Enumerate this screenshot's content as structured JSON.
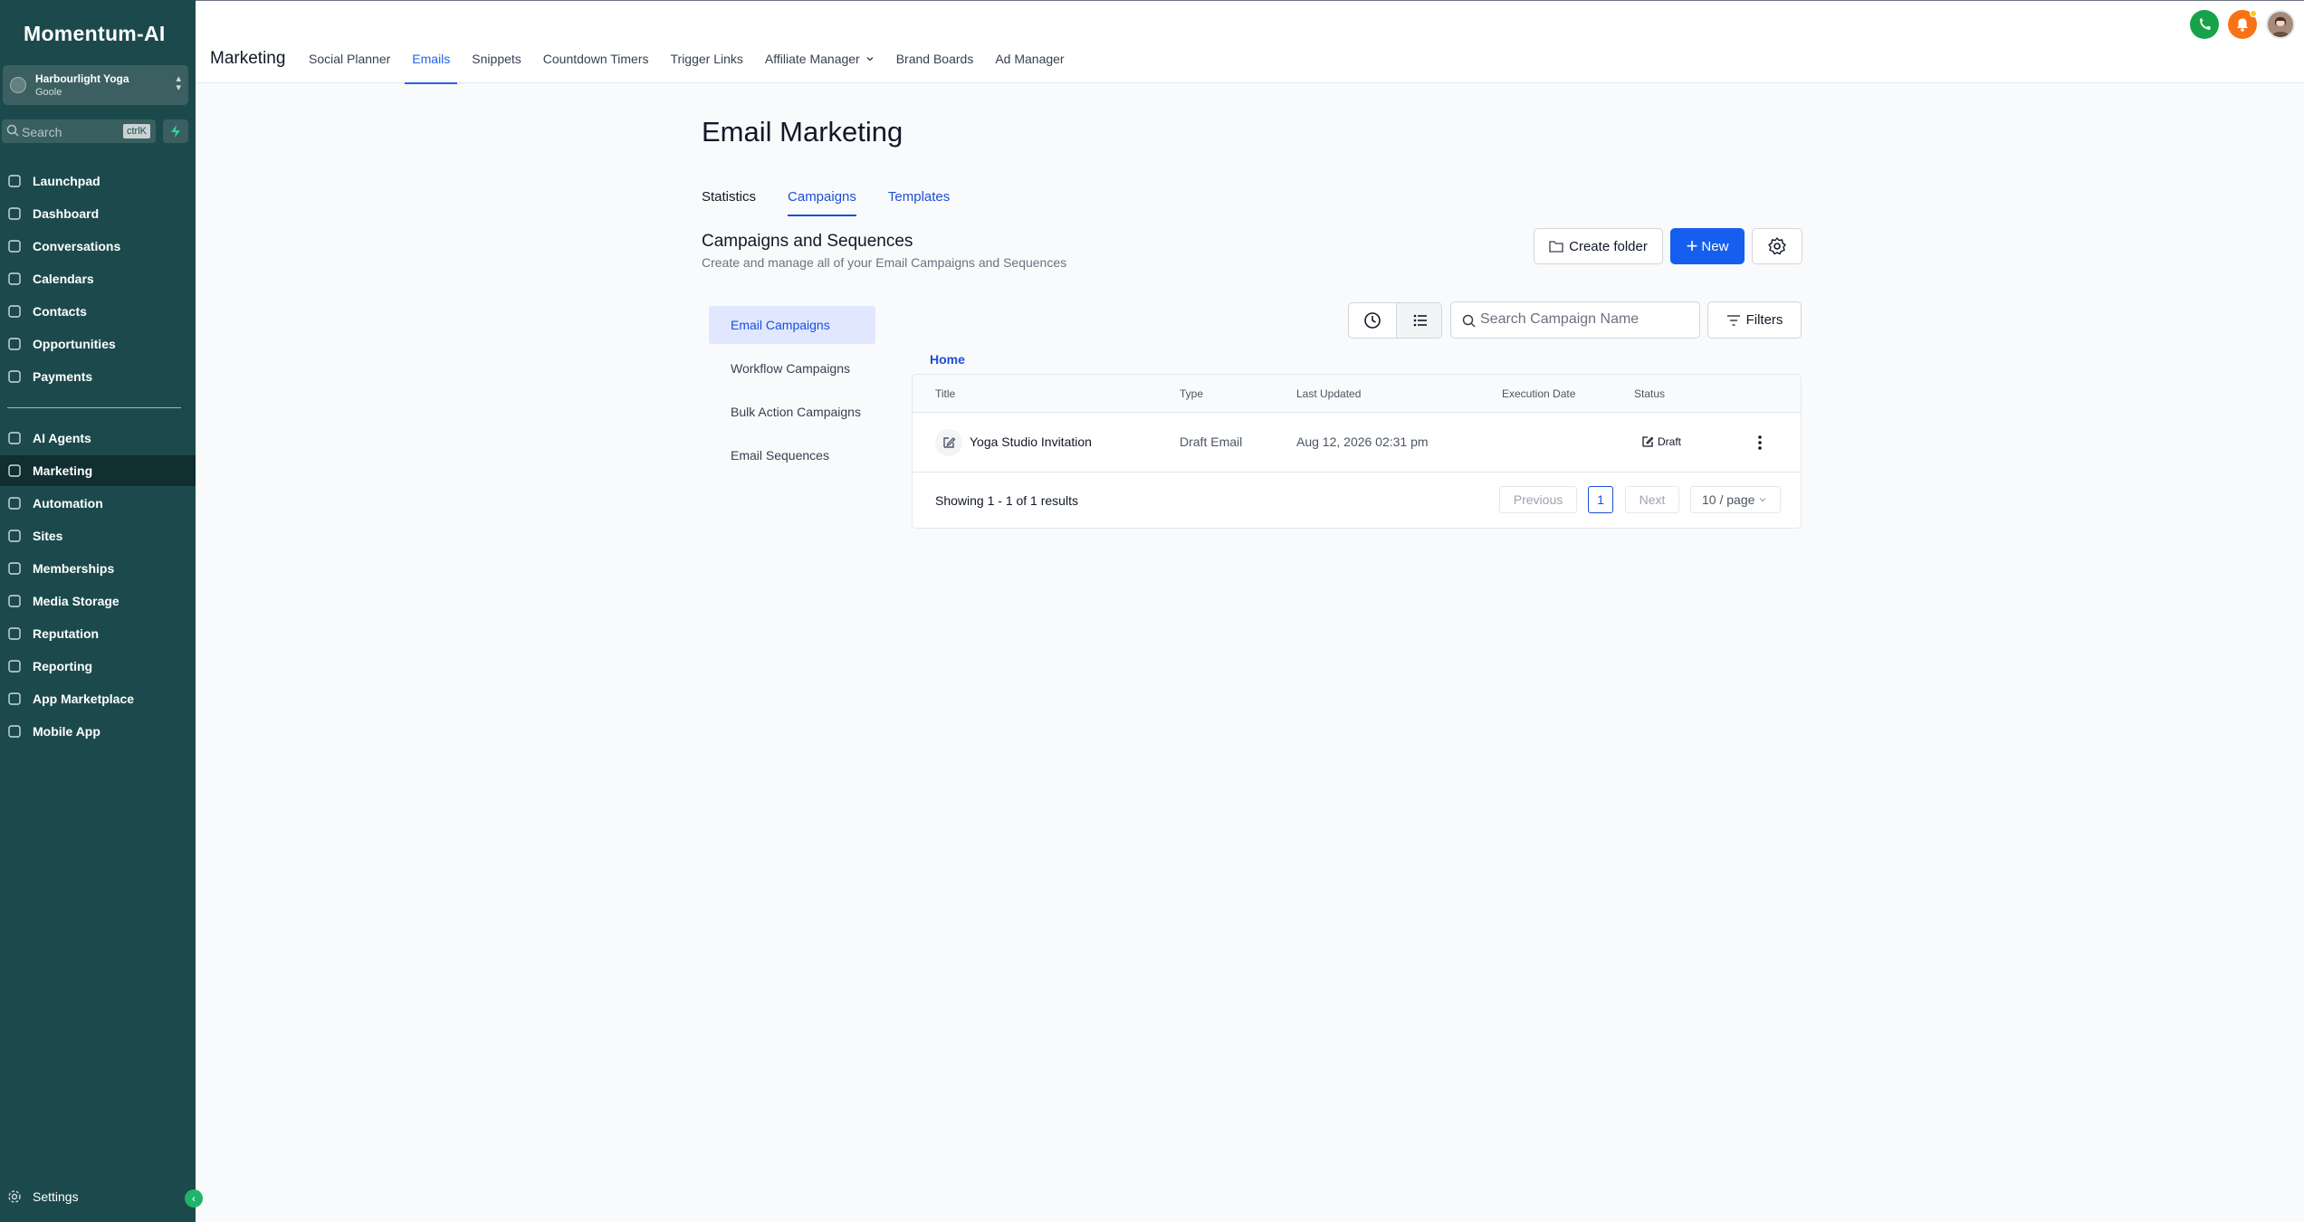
{
  "app": {
    "logo": "Momentum-AI"
  },
  "account": {
    "name": "Harbourlight Yoga",
    "sub": "Goole"
  },
  "search": {
    "placeholder": "Search",
    "shortcut": "ctrlK"
  },
  "sidebar": {
    "items": [
      {
        "label": "Launchpad",
        "icon": "launchpad-icon"
      },
      {
        "label": "Dashboard",
        "icon": "dashboard-icon"
      },
      {
        "label": "Conversations",
        "icon": "chat-icon"
      },
      {
        "label": "Calendars",
        "icon": "calendar-icon"
      },
      {
        "label": "Contacts",
        "icon": "contacts-icon"
      },
      {
        "label": "Opportunities",
        "icon": "opportunities-icon"
      },
      {
        "label": "Payments",
        "icon": "payments-icon"
      },
      {
        "label": "AI Agents",
        "icon": "ai-agents-icon"
      },
      {
        "label": "Marketing",
        "icon": "send-icon"
      },
      {
        "label": "Automation",
        "icon": "automation-icon"
      },
      {
        "label": "Sites",
        "icon": "sites-icon"
      },
      {
        "label": "Memberships",
        "icon": "memberships-icon"
      },
      {
        "label": "Media Storage",
        "icon": "media-icon"
      },
      {
        "label": "Reputation",
        "icon": "star-icon"
      },
      {
        "label": "Reporting",
        "icon": "reporting-icon"
      },
      {
        "label": "App Marketplace",
        "icon": "apps-icon"
      },
      {
        "label": "Mobile App",
        "icon": "mobile-icon"
      }
    ],
    "active": "Marketing",
    "settings": "Settings"
  },
  "header": {
    "title": "Marketing",
    "tabs": [
      "Social Planner",
      "Emails",
      "Snippets",
      "Countdown Timers",
      "Trigger Links",
      "Affiliate Manager",
      "Brand Boards",
      "Ad Manager"
    ],
    "active_tab": "Emails"
  },
  "page": {
    "title": "Email Marketing",
    "tabs": [
      "Statistics",
      "Campaigns",
      "Templates"
    ],
    "active_tab": "Campaigns",
    "section_title": "Campaigns and Sequences",
    "section_desc": "Create and manage all of your Email Campaigns and Sequences",
    "create_folder": "Create folder",
    "new": "New"
  },
  "campaign_types": [
    "Email Campaigns",
    "Workflow Campaigns",
    "Bulk Action Campaigns",
    "Email Sequences"
  ],
  "toolbar": {
    "search_placeholder": "Search Campaign Name",
    "filters": "Filters"
  },
  "breadcrumb": "Home",
  "table": {
    "columns": [
      "Title",
      "Type",
      "Last Updated",
      "Execution Date",
      "Status"
    ],
    "rows": [
      {
        "title": "Yoga Studio Invitation",
        "type": "Draft Email",
        "updated": "Aug 12, 2026 02:31 pm",
        "exec": "",
        "status": "Draft"
      }
    ]
  },
  "pagination": {
    "summary": "Showing 1 - 1 of 1 results",
    "prev": "Previous",
    "page": "1",
    "next": "Next",
    "per_page": "10 / page"
  },
  "colors": {
    "sidebar": "#1c4a4c",
    "sidebar_active": "#112e30",
    "primary": "#155eef",
    "link": "#1d4ed8"
  }
}
